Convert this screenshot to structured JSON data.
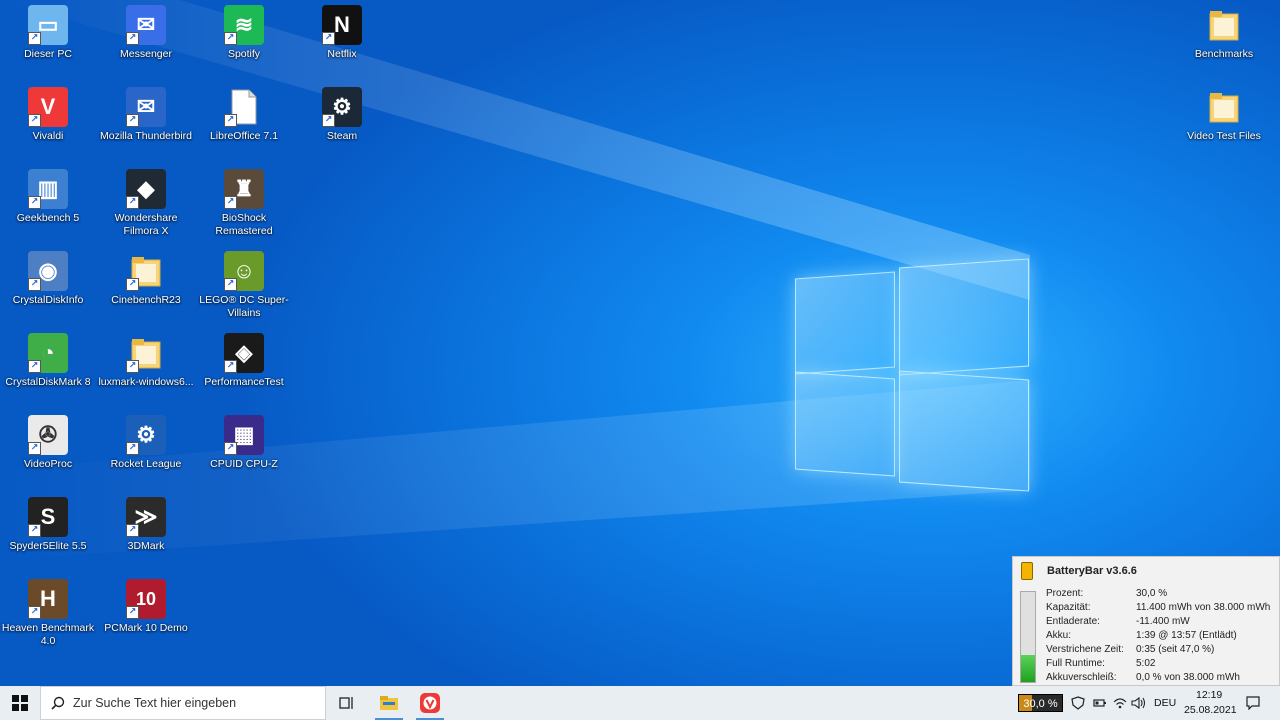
{
  "desktop_icons": [
    {
      "label": "Dieser PC",
      "icon": "computer-icon",
      "color": "#6fb6ef",
      "glyph": "▭"
    },
    {
      "label": "Vivaldi",
      "icon": "vivaldi-icon",
      "color": "#ef3939",
      "glyph": "V"
    },
    {
      "label": "Geekbench 5",
      "icon": "geekbench-icon",
      "color": "#3d7fd0",
      "glyph": "▥"
    },
    {
      "label": "CrystalDiskInfo",
      "icon": "crystaldiskinfo-icon",
      "color": "#4e7fc4",
      "glyph": "◉"
    },
    {
      "label": "CrystalDiskMark 8",
      "icon": "crystaldiskmark-icon",
      "color": "#3fae49",
      "glyph": "◔"
    },
    {
      "label": "VideoProc",
      "icon": "videoproc-icon",
      "color": "#eaeaea",
      "glyph": "✇"
    },
    {
      "label": "Spyder5Elite 5.5",
      "icon": "spyder-icon",
      "color": "#222222",
      "glyph": "S"
    },
    {
      "label": "Heaven Benchmark 4.0",
      "icon": "heaven-icon",
      "color": "#6b4a2a",
      "glyph": "H"
    },
    {
      "label": "Messenger",
      "icon": "messenger-icon",
      "color": "#3a6ee8",
      "glyph": "✉"
    },
    {
      "label": "Mozilla Thunderbird",
      "icon": "thunderbird-icon",
      "color": "#2a66c8",
      "glyph": "✉"
    },
    {
      "label": "Wondershare Filmora X",
      "icon": "filmora-icon",
      "color": "#1f2a34",
      "glyph": "◆"
    },
    {
      "label": "CinebenchR23",
      "icon": "folder-icon",
      "color": "#f3d070",
      "glyph": ""
    },
    {
      "label": "luxmark-windows6...",
      "icon": "folder-icon",
      "color": "#f3d070",
      "glyph": ""
    },
    {
      "label": "Rocket League",
      "icon": "rocket-league-icon",
      "color": "#1b5fb8",
      "glyph": "⚙"
    },
    {
      "label": "3DMark",
      "icon": "3dmark-icon",
      "color": "#2b2b2b",
      "glyph": "≫"
    },
    {
      "label": "PCMark 10 Demo",
      "icon": "pcmark-icon",
      "color": "#b01c2e",
      "glyph": "10"
    },
    {
      "label": "Spotify",
      "icon": "spotify-icon",
      "color": "#1db954",
      "glyph": "≋"
    },
    {
      "label": "LibreOffice 7.1",
      "icon": "libreoffice-icon",
      "color": "#f2f2f2",
      "glyph": ""
    },
    {
      "label": "BioShock Remastered",
      "icon": "bioshock-icon",
      "color": "#5a4a3a",
      "glyph": "♜"
    },
    {
      "label": "LEGO® DC Super-Villains",
      "icon": "lego-icon",
      "color": "#6a9a2a",
      "glyph": "☺"
    },
    {
      "label": "PerformanceTest",
      "icon": "performancetest-icon",
      "color": "#1a1a1a",
      "glyph": "◈"
    },
    {
      "label": "CPUID CPU-Z",
      "icon": "cpuz-icon",
      "color": "#3a2a8a",
      "glyph": "▦"
    },
    {
      "label": "Netflix",
      "icon": "netflix-icon",
      "color": "#111111",
      "glyph": "N"
    },
    {
      "label": "Steam",
      "icon": "steam-icon",
      "color": "#1b2838",
      "glyph": "⚙"
    },
    {
      "label": "Benchmarks",
      "icon": "folder-icon",
      "color": "#f3d070",
      "glyph": ""
    },
    {
      "label": "Video Test Files",
      "icon": "folder-icon",
      "color": "#f3d070",
      "glyph": ""
    }
  ],
  "batterybar": {
    "title": "BatteryBar v3.6.6",
    "level_percent": 30,
    "rows": [
      {
        "key": "Prozent:",
        "value": "30,0 %"
      },
      {
        "key": "Kapazität:",
        "value": "11.400 mWh von 38.000 mWh"
      },
      {
        "key": "Entladerate:",
        "value": "-11.400 mW"
      },
      {
        "key": "Akku:",
        "value": "1:39 @ 13:57 (Entlädt)"
      },
      {
        "key": "Verstrichene Zeit:",
        "value": "0:35 (seit 47,0 %)"
      },
      {
        "key": "Full Runtime:",
        "value": "5:02"
      },
      {
        "key": "Akkuverschleiß:",
        "value": "0,0 % von 38.000 mWh"
      }
    ]
  },
  "taskbar": {
    "search_placeholder": "Zur Suche Text hier eingeben",
    "battery_text": "30,0 %",
    "battery_level": 30,
    "language": "DEU",
    "time": "12:19",
    "date": "25.08.2021"
  }
}
